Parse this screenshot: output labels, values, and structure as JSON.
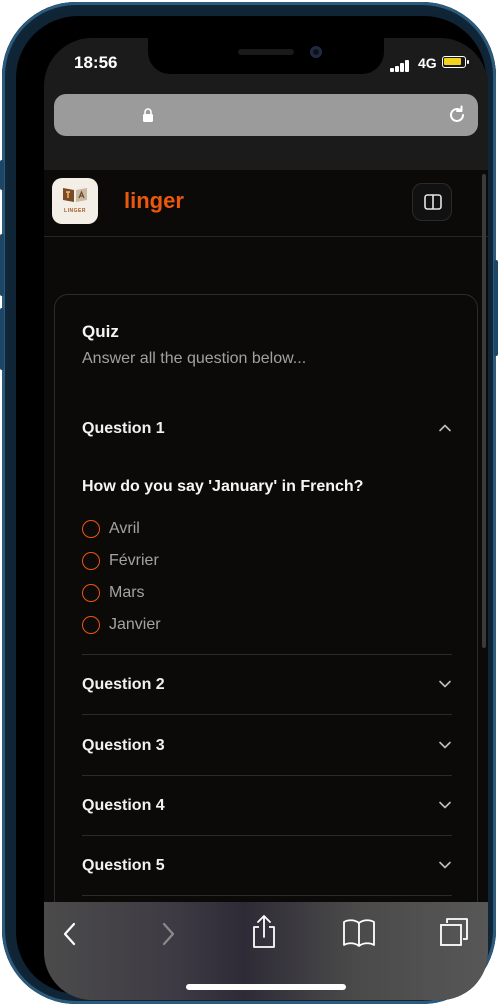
{
  "status_bar": {
    "time": "18:56",
    "network": "4G"
  },
  "colors": {
    "accent": "#ea580c",
    "background": "#0c0a09",
    "battery": "#f5d21f"
  },
  "header": {
    "brand": "linger",
    "logo_icon": "linger-logo-icon",
    "sidebar_toggle_icon": "sidebar-panel-icon"
  },
  "quiz": {
    "title": "Quiz",
    "subtitle": "Answer all the question below...",
    "questions": [
      {
        "label": "Question 1",
        "expanded": true,
        "icon": "chevron-up-icon",
        "prompt": "How do you say 'January' in French?",
        "options": [
          "Avril",
          "Février",
          "Mars",
          "Janvier"
        ]
      },
      {
        "label": "Question 2",
        "expanded": false,
        "icon": "chevron-down-icon"
      },
      {
        "label": "Question 3",
        "expanded": false,
        "icon": "chevron-down-icon"
      },
      {
        "label": "Question 4",
        "expanded": false,
        "icon": "chevron-down-icon"
      },
      {
        "label": "Question 5",
        "expanded": false,
        "icon": "chevron-down-icon"
      }
    ]
  },
  "browser_toolbar": {
    "icons": [
      "back-icon",
      "forward-icon",
      "share-icon",
      "bookmarks-icon",
      "tabs-icon"
    ]
  }
}
